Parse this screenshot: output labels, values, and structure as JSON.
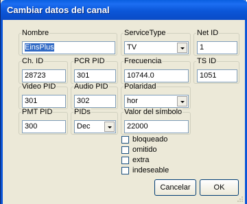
{
  "window": {
    "title": "Cambiar datos del canal"
  },
  "fields": {
    "nombre": {
      "label": "Nombre",
      "value": "EinsPlus"
    },
    "service_type": {
      "label": "ServiceType",
      "value": "TV"
    },
    "net_id": {
      "label": "Net ID",
      "value": "1"
    },
    "ch_id": {
      "label": "Ch. ID",
      "value": "28723"
    },
    "pcr_pid": {
      "label": "PCR PID",
      "value": "301"
    },
    "frecuencia": {
      "label": "Frecuencia",
      "value": "10744.0"
    },
    "ts_id": {
      "label": "TS ID",
      "value": "1051"
    },
    "video_pid": {
      "label": "Video PID",
      "value": "301"
    },
    "audio_pid": {
      "label": "Audio PID",
      "value": "302"
    },
    "polaridad": {
      "label": "Polaridad",
      "value": "hor"
    },
    "pmt_pid": {
      "label": "PMT PID",
      "value": "300"
    },
    "pids": {
      "label": "PIDs",
      "value": "Dec"
    },
    "valor_simbolo": {
      "label": "Valor del símbolo",
      "value": "22000"
    }
  },
  "checkboxes": [
    {
      "label": "bloqueado",
      "checked": false
    },
    {
      "label": "omitido",
      "checked": false
    },
    {
      "label": "extra",
      "checked": false
    },
    {
      "label": "indeseable",
      "checked": false
    }
  ],
  "buttons": {
    "cancel": "Cancelar",
    "ok": "OK"
  }
}
